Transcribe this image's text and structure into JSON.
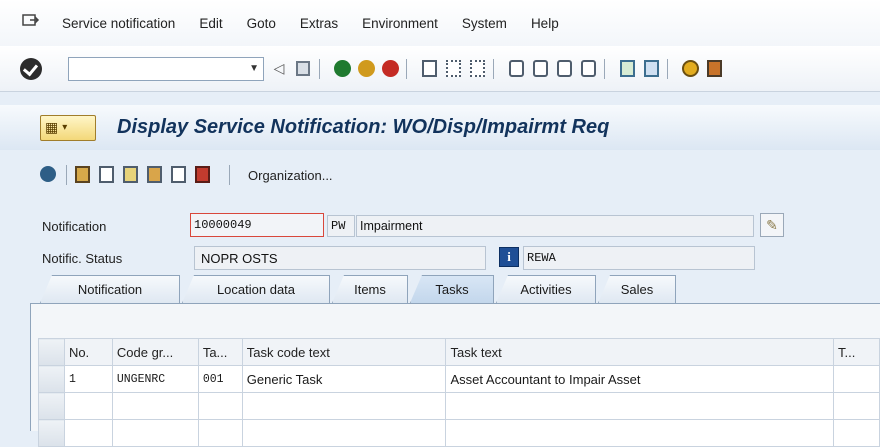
{
  "menubar": {
    "items": [
      "Service notification",
      "Edit",
      "Goto",
      "Extras",
      "Environment",
      "System",
      "Help"
    ]
  },
  "toolbar": {
    "command_value": "",
    "icons": [
      "enter-icon",
      "command-dropdown-icon",
      "back-nav-icon",
      "save-icon",
      "back-icon",
      "exit-icon",
      "cancel-icon",
      "print-icon",
      "find-icon",
      "find-next-icon",
      "first-page-icon",
      "previous-page-icon",
      "next-page-icon",
      "last-page-icon",
      "create-session-icon",
      "shortcut-icon",
      "help-icon",
      "customize-icon"
    ]
  },
  "title": {
    "text": "Display Service Notification: WO/Disp/Impairmt Req"
  },
  "apptoolbar": {
    "organization_label": "Organization..."
  },
  "header": {
    "notification_label": "Notification",
    "notification_number": "10000049",
    "notification_type": "PW",
    "notification_description": "Impairment",
    "status_label": "Notific. Status",
    "status_value": "NOPR OSTS",
    "user_status": "REWA"
  },
  "tabs": [
    "Notification",
    "Location data",
    "Items",
    "Tasks",
    "Activities",
    "Sales"
  ],
  "active_tab": "Tasks",
  "table": {
    "columns": [
      "No.",
      "Code gr...",
      "Ta...",
      "Task code text",
      "Task text",
      "T..."
    ],
    "rows": [
      {
        "no": "1",
        "code_group": "UNGENRC",
        "task": "001",
        "task_code_text": "Generic Task",
        "task_text": "Asset Accountant to Impair Asset",
        "t": ""
      }
    ]
  },
  "colors": {
    "title_text": "#12335c",
    "background": "#e6eef7",
    "required_border": "#d9473b"
  }
}
